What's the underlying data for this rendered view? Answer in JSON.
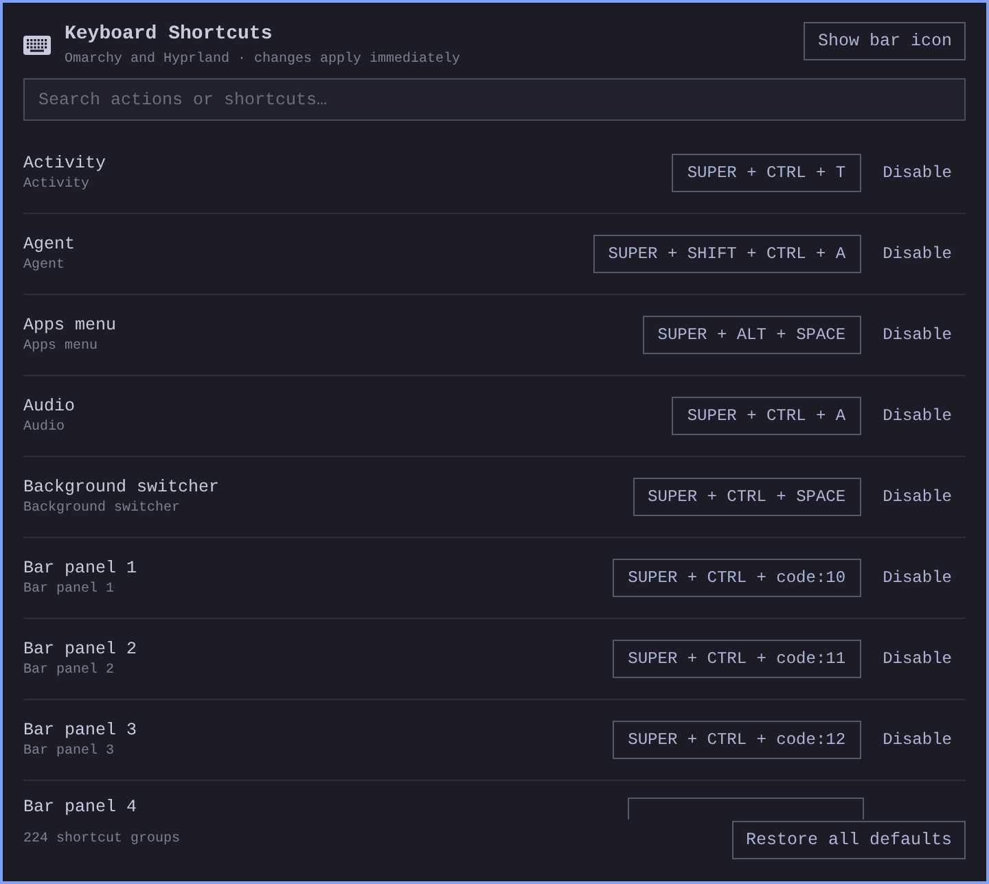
{
  "header": {
    "title": "Keyboard Shortcuts",
    "subtitle": "Omarchy and Hyprland · changes apply immediately",
    "button": "Show bar icon"
  },
  "search": {
    "placeholder": "Search actions or shortcuts…"
  },
  "shortcuts": [
    {
      "name": "Activity",
      "description": "Activity",
      "keys": "SUPER + CTRL + T",
      "action": "Disable"
    },
    {
      "name": "Agent",
      "description": "Agent",
      "keys": "SUPER + SHIFT + CTRL + A",
      "action": "Disable"
    },
    {
      "name": "Apps menu",
      "description": "Apps menu",
      "keys": "SUPER + ALT + SPACE",
      "action": "Disable"
    },
    {
      "name": "Audio",
      "description": "Audio",
      "keys": "SUPER + CTRL + A",
      "action": "Disable"
    },
    {
      "name": "Background switcher",
      "description": "Background switcher",
      "keys": "SUPER + CTRL + SPACE",
      "action": "Disable"
    },
    {
      "name": "Bar panel 1",
      "description": "Bar panel 1",
      "keys": "SUPER + CTRL + code:10",
      "action": "Disable"
    },
    {
      "name": "Bar panel 2",
      "description": "Bar panel 2",
      "keys": "SUPER + CTRL + code:11",
      "action": "Disable"
    },
    {
      "name": "Bar panel 3",
      "description": "Bar panel 3",
      "keys": "SUPER + CTRL + code:12",
      "action": "Disable"
    },
    {
      "name": "Bar panel 4"
    }
  ],
  "footer": {
    "count": "224 shortcut groups",
    "button": "Restore all defaults"
  }
}
